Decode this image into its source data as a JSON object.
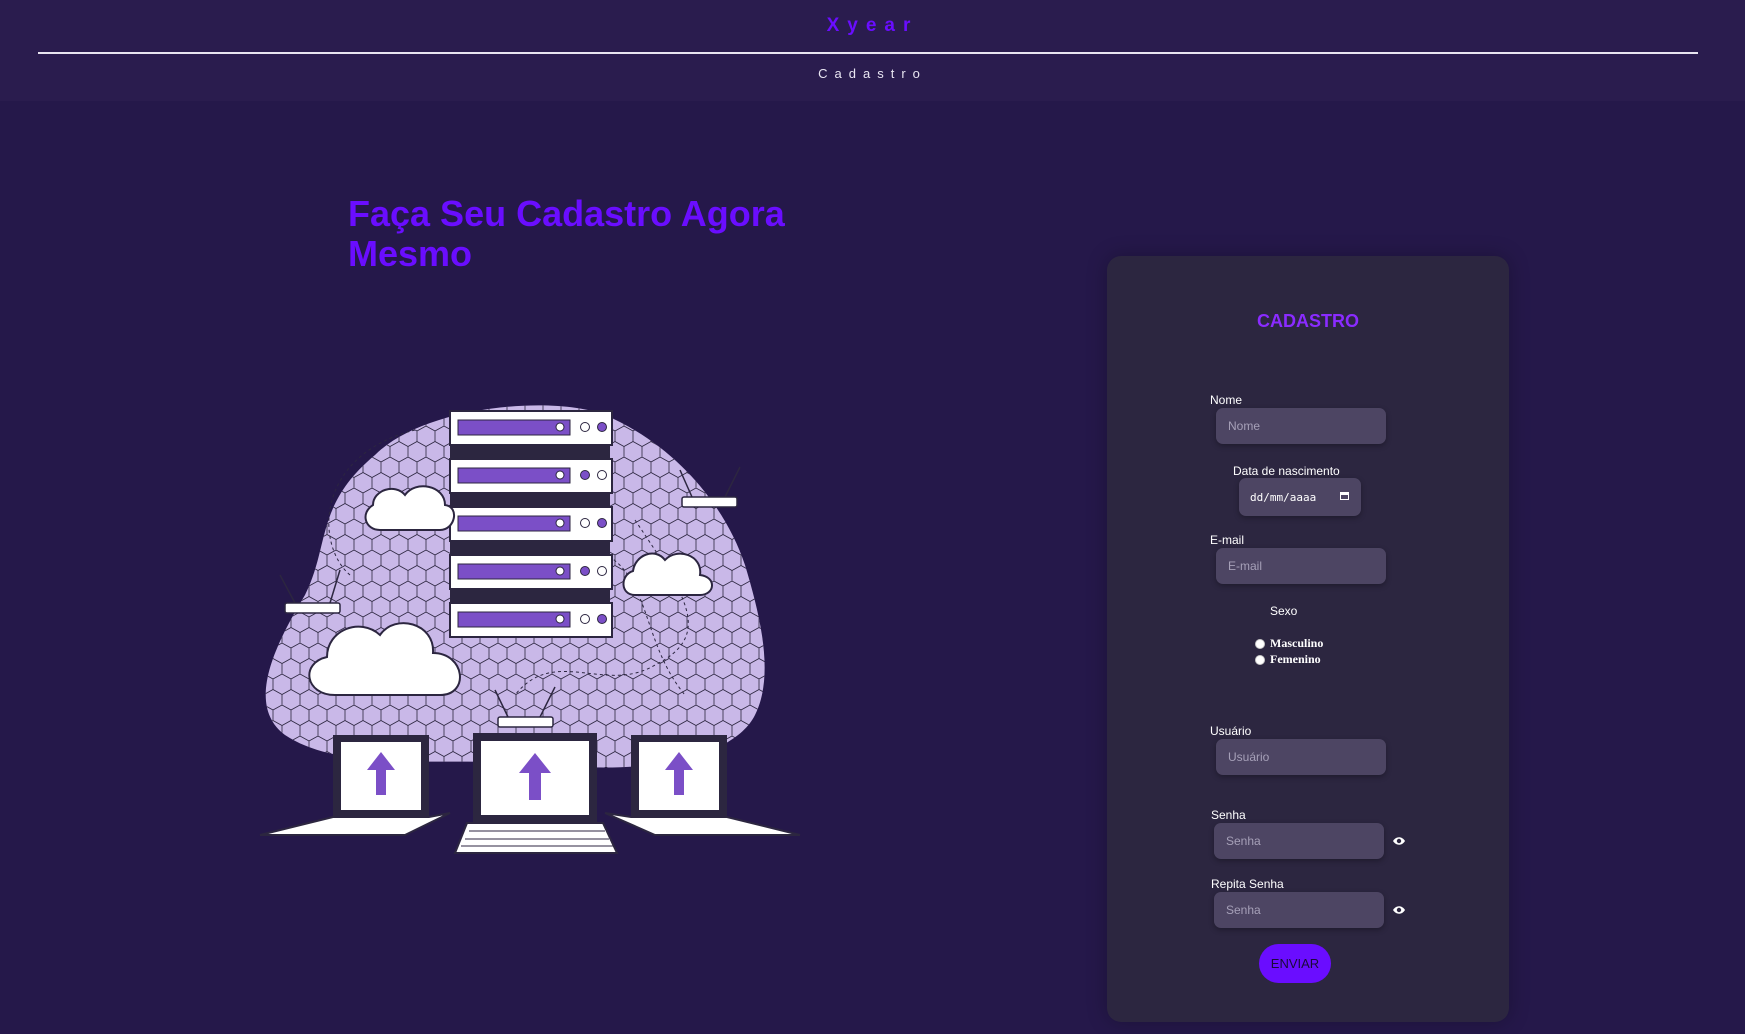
{
  "header": {
    "brand": "Xyear",
    "subtitle": "Cadastro"
  },
  "hero": {
    "title": "Faça Seu Cadastro Agora Mesmo"
  },
  "form": {
    "title": "CADASTRO",
    "nome_label": "Nome",
    "nome_placeholder": "Nome",
    "nascimento_label": "Data de nascimento",
    "nascimento_placeholder": "dd/mm/aaaa",
    "email_label": "E-mail",
    "email_placeholder": "E-mail",
    "sexo_label": "Sexo",
    "sexo_options": [
      "Masculino",
      "Femenino"
    ],
    "usuario_label": "Usuário",
    "usuario_placeholder": "Usuário",
    "senha_label": "Senha",
    "senha_placeholder": "Senha",
    "repita_label": "Repita Senha",
    "repita_placeholder": "Senha",
    "submit_label": "ENVIAR"
  },
  "colors": {
    "background": "#25184a",
    "accent": "#6a0dff",
    "card": "#2c2640",
    "input": "#4d4563"
  }
}
